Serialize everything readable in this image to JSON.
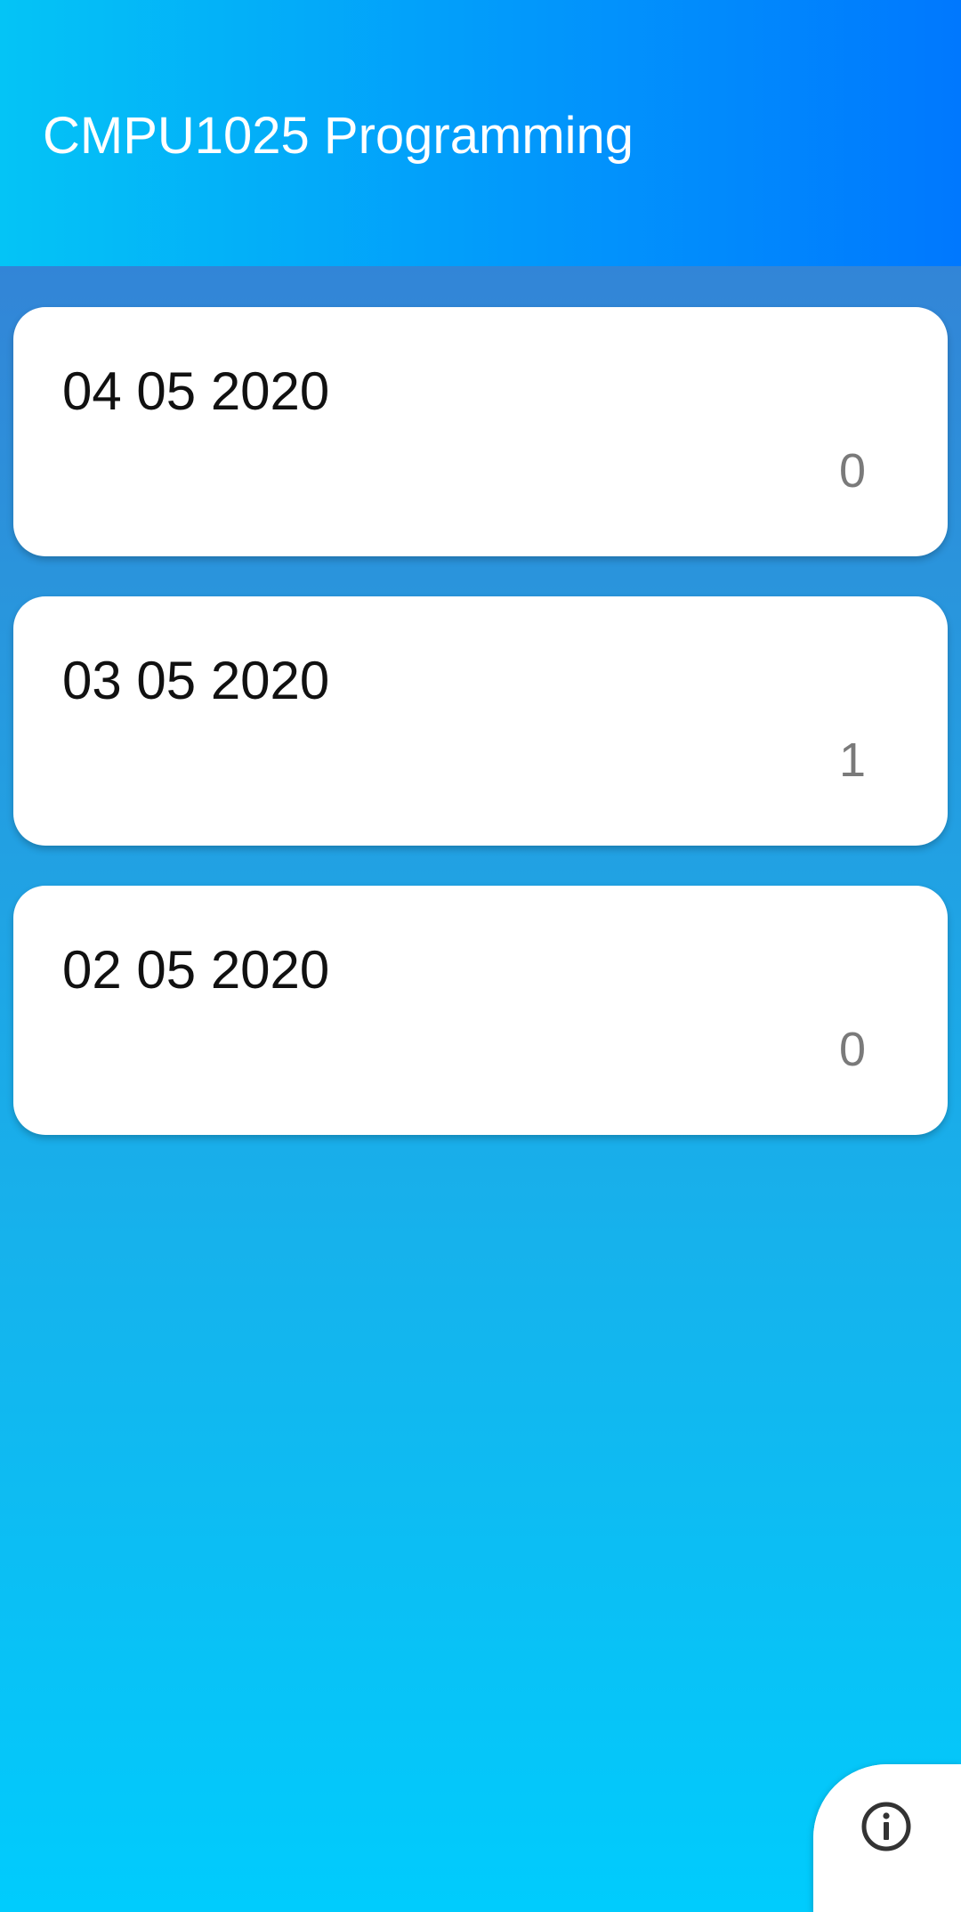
{
  "app_bar": {
    "title": "CMPU1025 Programming",
    "gradient": [
      "#04c4f6",
      "#0078fe"
    ]
  },
  "background": {
    "gradient": [
      "#3a78d2",
      "#00ccfd"
    ]
  },
  "cards": [
    {
      "date": "04 05 2020",
      "count": "0"
    },
    {
      "date": "03 05 2020",
      "count": "1"
    },
    {
      "date": "02 05 2020",
      "count": "0"
    }
  ],
  "fab": {
    "icon": "info-icon",
    "icon_color": "#333333"
  }
}
